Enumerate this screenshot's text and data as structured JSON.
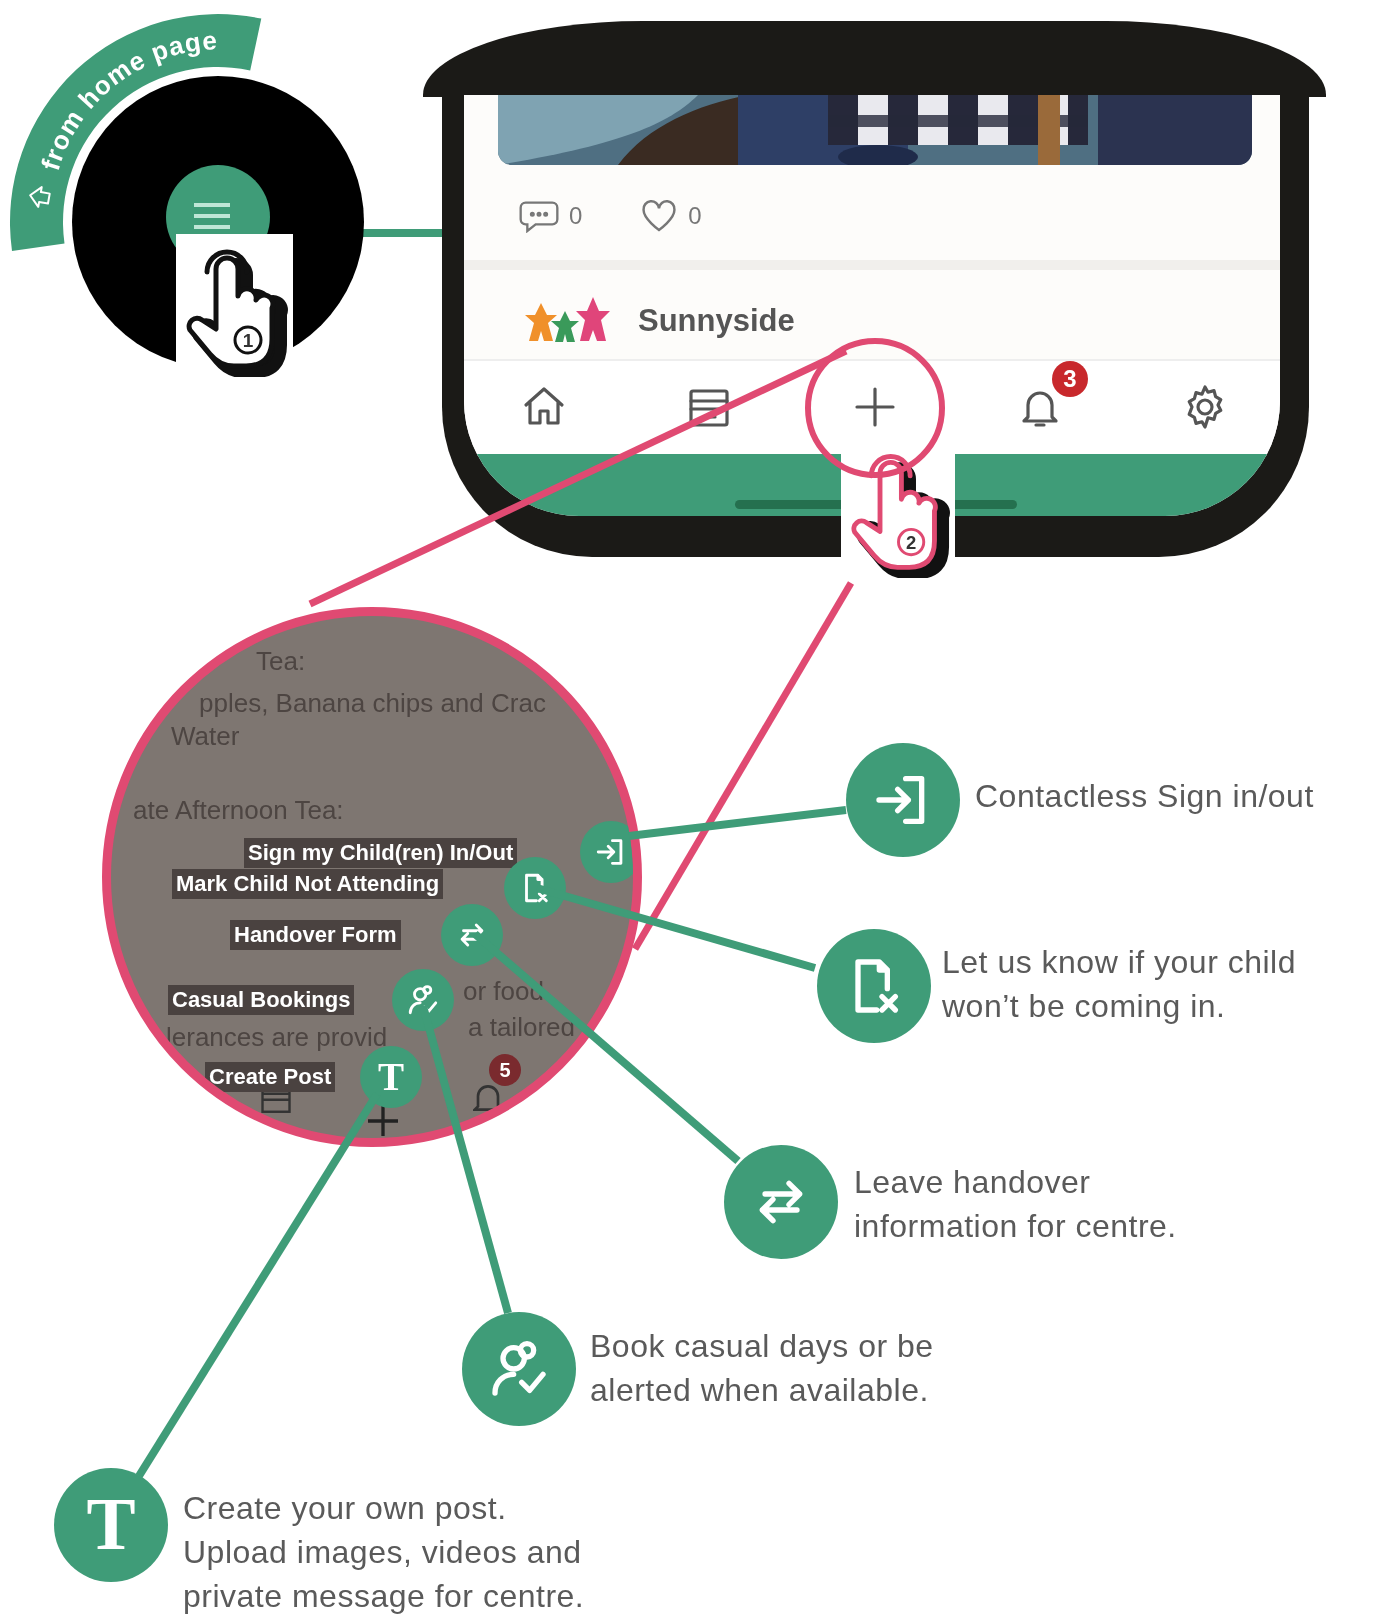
{
  "start_badge": {
    "label": "from home page"
  },
  "steps": [
    {
      "number": "1"
    },
    {
      "number": "2"
    }
  ],
  "phone": {
    "post": {
      "comments": "0",
      "likes": "0",
      "author": "Sunnyside"
    },
    "nav": [
      {
        "kind": "home"
      },
      {
        "kind": "calendar"
      },
      {
        "kind": "plus"
      },
      {
        "kind": "bell",
        "badge": "3"
      },
      {
        "kind": "settings"
      }
    ]
  },
  "zoom": {
    "background_text": [
      "Tea:",
      "pples, Banana chips and Crac",
      "Water",
      "ate Afternoon Tea:",
      "or food",
      "lerances are provid",
      "a tailored"
    ],
    "menu": [
      {
        "kind": "sign-in",
        "label": "Sign my Child(ren) In/Out"
      },
      {
        "kind": "not-attending",
        "label": "Mark Child Not Attending"
      },
      {
        "kind": "handover",
        "label": "Handover Form"
      },
      {
        "kind": "casual",
        "label": "Casual Bookings"
      },
      {
        "kind": "post",
        "label": "Create Post",
        "glyph": "T"
      }
    ],
    "nav_badge": "5"
  },
  "callouts": [
    {
      "kind": "sign-in",
      "lines": [
        "Contactless Sign in/out"
      ]
    },
    {
      "kind": "not-attending",
      "lines": [
        "Let us know if your child",
        "won’t be coming in."
      ]
    },
    {
      "kind": "handover",
      "lines": [
        "Leave handover",
        "information for centre."
      ]
    },
    {
      "kind": "casual",
      "lines": [
        "Book casual days or be",
        "alerted when available."
      ]
    },
    {
      "kind": "post",
      "glyph": "T",
      "lines": [
        "Create your own post.",
        "Upload images, videos and",
        "private message for centre."
      ]
    }
  ]
}
